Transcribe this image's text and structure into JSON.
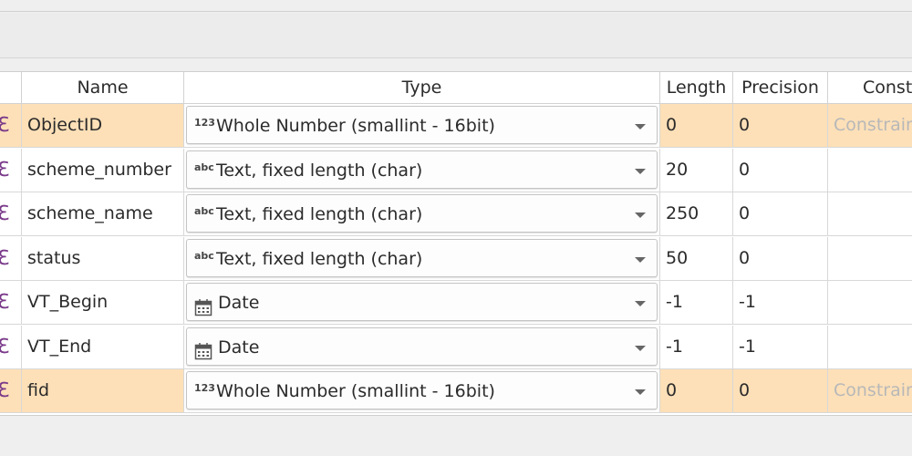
{
  "columns": {
    "name": "Name",
    "type": "Type",
    "length": "Length",
    "precision": "Precision",
    "constraints": "Const"
  },
  "rows": [
    {
      "control": "ℇ",
      "name": "ObjectID",
      "type_prefix": "123",
      "type_icon": "number-icon",
      "type": "Whole Number (smallint - 16bit)",
      "length": "0",
      "precision": "0",
      "constraints": "Constrain",
      "highlighted": true
    },
    {
      "control": "ℇ",
      "name": "scheme_number",
      "type_prefix": "abc",
      "type_icon": "text-icon",
      "type": "Text, fixed length (char)",
      "length": "20",
      "precision": "0",
      "constraints": "",
      "highlighted": false
    },
    {
      "control": "ℇ",
      "name": "scheme_name",
      "type_prefix": "abc",
      "type_icon": "text-icon",
      "type": "Text, fixed length (char)",
      "length": "250",
      "precision": "0",
      "constraints": "",
      "highlighted": false
    },
    {
      "control": "ℇ",
      "name": "status",
      "type_prefix": "abc",
      "type_icon": "text-icon",
      "type": "Text, fixed length (char)",
      "length": "50",
      "precision": "0",
      "constraints": "",
      "highlighted": false
    },
    {
      "control": "ℇ",
      "name": "VT_Begin",
      "type_prefix": "",
      "type_icon": "calendar-icon",
      "type": "Date",
      "length": "-1",
      "precision": "-1",
      "constraints": "",
      "highlighted": false
    },
    {
      "control": "ℇ",
      "name": "VT_End",
      "type_prefix": "",
      "type_icon": "calendar-icon",
      "type": "Date",
      "length": "-1",
      "precision": "-1",
      "constraints": "",
      "highlighted": false
    },
    {
      "control": "ℇ",
      "name": "fid",
      "type_prefix": "123",
      "type_icon": "number-icon",
      "type": "Whole Number (smallint - 16bit)",
      "length": "0",
      "precision": "0",
      "constraints": "Constrain",
      "highlighted": true
    }
  ],
  "colors": {
    "highlight": "#fde0b8",
    "accent_icon": "#7a3a8a"
  }
}
